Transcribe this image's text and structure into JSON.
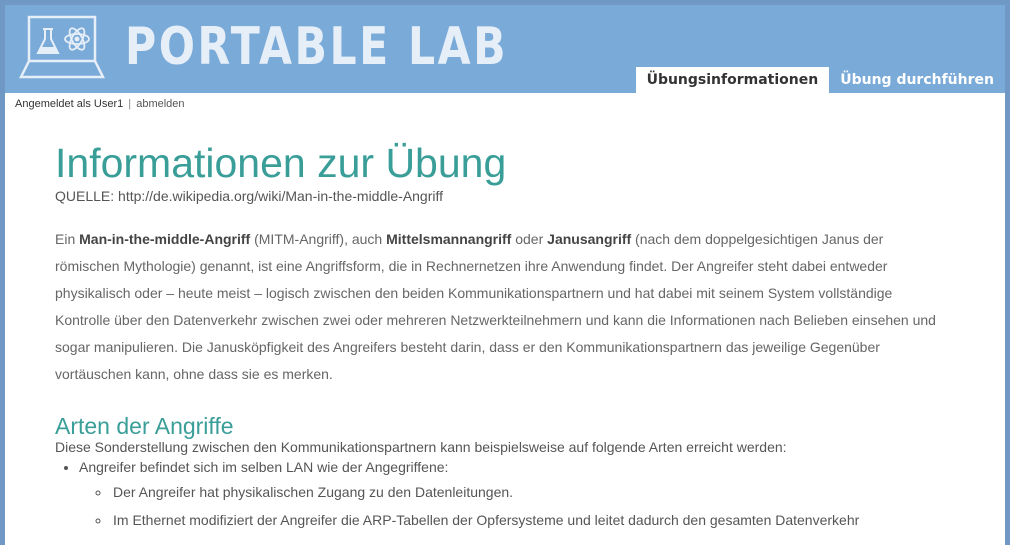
{
  "header": {
    "logo_text": "PORTABLE LAB",
    "tabs": [
      {
        "label": "Übungsinformationen",
        "active": true
      },
      {
        "label": "Übung durchführen",
        "active": false
      }
    ]
  },
  "userbar": {
    "logged_in_text": "Angemeldet als User1",
    "separator": "|",
    "logout_label": "abmelden"
  },
  "main": {
    "title": "Informationen zur Übung",
    "source": "QUELLE: http://de.wikipedia.org/wiki/Man-in-the-middle-Angriff",
    "intro": {
      "p1": "Ein ",
      "b1": "Man-in-the-middle-Angriff",
      "p2": " (MITM-Angriff), auch ",
      "b2": "Mittelsmannangriff",
      "p3": " oder ",
      "b3": "Janusangriff",
      "p4": " (nach dem doppelgesichtigen Janus der römischen Mythologie) genannt, ist eine Angriffsform, die in Rechnernetzen ihre Anwendung findet. Der Angreifer steht dabei entweder physikalisch oder – heute meist – logisch zwischen den beiden Kommunikationspartnern und hat dabei mit seinem System vollständige Kontrolle über den Datenverkehr zwischen zwei oder mehreren Netzwerkteilnehmern und kann die Informationen nach Belieben einsehen und sogar manipulieren. Die Janusköpfigkeit des Angreifers besteht darin, dass er den Kommunikationspartnern das jeweilige Gegenüber vortäuschen kann, ohne dass sie es merken."
    },
    "section_heading": "Arten der Angriffe",
    "section_lead": "Diese Sonderstellung zwischen den Kommunikationspartnern kann beispielsweise auf folgende Arten erreicht werden:",
    "list": {
      "item1": "Angreifer befindet sich im selben LAN wie der Angegriffene:",
      "sub1": "Der Angreifer hat physikalischen Zugang zu den Datenleitungen.",
      "sub2": "Im Ethernet modifiziert der Angreifer die ARP-Tabellen der Opfersysteme und leitet dadurch den gesamten Datenverkehr"
    }
  },
  "colors": {
    "header_bg": "#7aaad8",
    "frame": "#6f98c4",
    "heading": "#3a9e98"
  },
  "icons": [
    "laptop-lab-icon",
    "atom-icon",
    "flask-icon"
  ]
}
